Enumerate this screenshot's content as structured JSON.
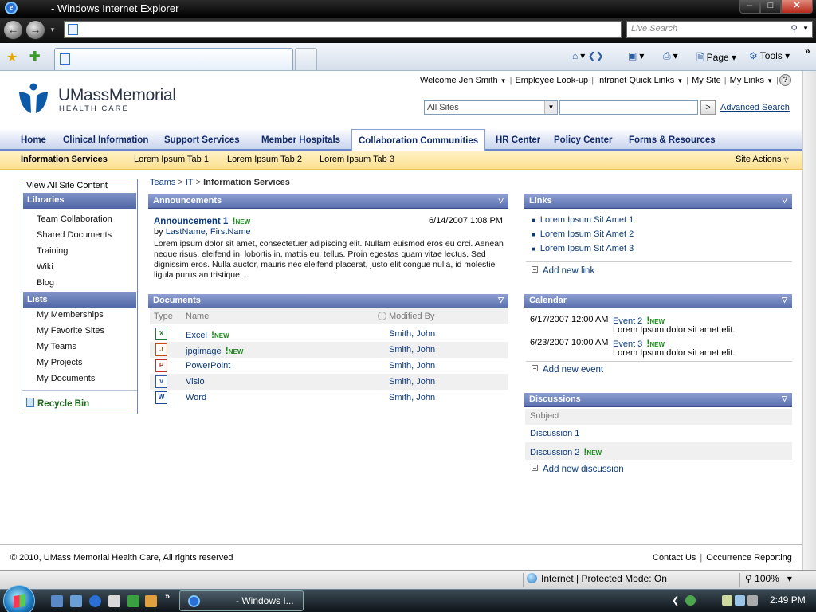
{
  "browser": {
    "title": "- Windows Internet Explorer",
    "search_placeholder": "Live Search",
    "commands": {
      "page": "Page",
      "tools": "Tools"
    },
    "status_zone": "Internet | Protected Mode: On",
    "zoom": "100%"
  },
  "site": {
    "logo_name": "UMassMemorial",
    "logo_sub": "HEALTH CARE",
    "brand_color": "#0b5aa8"
  },
  "topnav": {
    "welcome": "Welcome Jen Smith",
    "employee_lookup": "Employee Look-up",
    "intranet_links": "Intranet Quick Links",
    "my_site": "My Site",
    "my_links": "My Links"
  },
  "search": {
    "scope": "All Sites",
    "go": ">",
    "advanced": "Advanced Search"
  },
  "mainnav": [
    "Home",
    "Clinical Information",
    "Support Services",
    "Member Hospitals",
    "Collaboration Communities",
    "HR Center",
    "Policy Center",
    "Forms & Resources"
  ],
  "subnav": {
    "tabs": [
      "Information Services",
      "Lorem Ipsum Tab 1",
      "Lorem Ipsum Tab 2",
      "Lorem Ipsum Tab 3"
    ],
    "site_actions": "Site Actions"
  },
  "quicklaunch": {
    "view_all": "View All Site Content",
    "libraries_head": "Libraries",
    "libraries": [
      "Team Collaboration",
      "Shared Documents",
      "Training",
      "Wiki",
      "Blog"
    ],
    "lists_head": "Lists",
    "lists": [
      "My Memberships",
      "My Favorite Sites",
      "My Teams",
      "My Projects",
      "My Documents"
    ],
    "recycle": "Recycle Bin"
  },
  "breadcrumb": {
    "a": "Teams",
    "b": "IT",
    "current": "Information Services",
    "sep": ">"
  },
  "new_label": "NEW",
  "announcements": {
    "header": "Announcements",
    "title": "Announcement 1",
    "date": "6/14/2007 1:08 PM",
    "by": "by",
    "author": "LastName, FirstName",
    "body": "Lorem ipsum dolor sit amet, consectetuer adipiscing elit. Nullam euismod eros eu orci. Aenean neque risus, eleifend in, lobortis in, mattis eu, tellus. Proin egestas quam vitae lectus. Sed dignissim eros. Nulla auctor, mauris nec eleifend placerat, justo elit congue nulla, id molestie ligula purus an tristique ..."
  },
  "documents": {
    "header": "Documents",
    "col_type": "Type",
    "col_name": "Name",
    "col_modified": "Modified By",
    "rows": [
      {
        "name": "Excel",
        "by": "Smith, John",
        "icon": "X"
      },
      {
        "name": "jpgimage",
        "by": "Smith, John",
        "icon": "J"
      },
      {
        "name": "PowerPoint",
        "by": "Smith, John",
        "icon": "P"
      },
      {
        "name": "Visio",
        "by": "Smith, John",
        "icon": "V"
      },
      {
        "name": "Word",
        "by": "Smith, John",
        "icon": "W"
      }
    ]
  },
  "links": {
    "header": "Links",
    "items": [
      "Lorem Ipsum Sit Amet 1",
      "Lorem Ipsum Sit Amet 2",
      "Lorem Ipsum Sit Amet 3"
    ],
    "add": "Add new link"
  },
  "calendar": {
    "header": "Calendar",
    "events": [
      {
        "date": "6/17/2007 12:00 AM",
        "title": "Event 2",
        "desc": "Lorem Ipsum dolor sit amet elit."
      },
      {
        "date": "6/23/2007 10:00 AM",
        "title": "Event 3",
        "desc": "Lorem Ipsum dolor sit amet elit."
      }
    ],
    "add": "Add new event"
  },
  "discussions": {
    "header": "Discussions",
    "col_subject": "Subject",
    "items": [
      "Discussion 1",
      "Discussion 2"
    ],
    "add": "Add new discussion"
  },
  "footer": {
    "copyright": "© 2010, UMass Memorial Health Care, All rights reserved",
    "contact": "Contact Us",
    "occurrence": "Occurrence Reporting"
  },
  "taskbar": {
    "ie_task": "- Windows I...",
    "clock": "2:49 PM"
  }
}
